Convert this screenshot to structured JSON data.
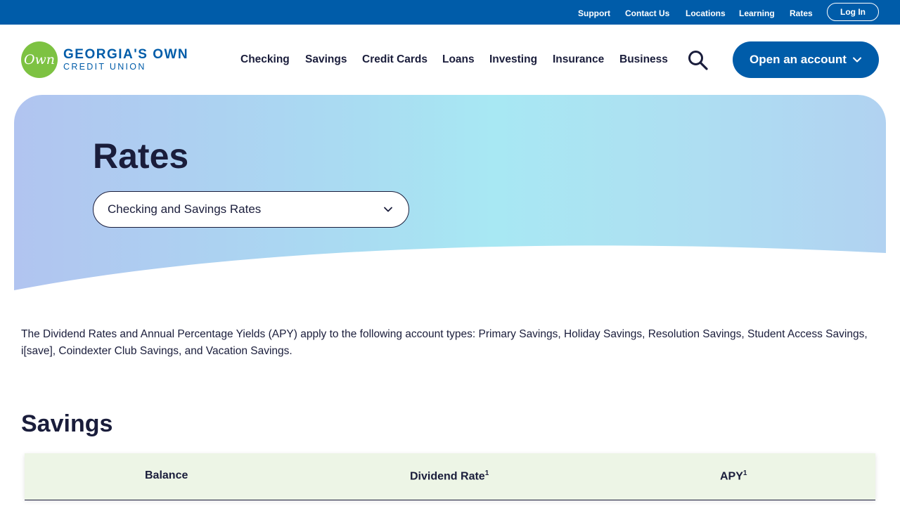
{
  "utility": {
    "links": [
      "Support",
      "Contact Us",
      "Locations",
      "Learning",
      "Rates"
    ],
    "login_label": "Log In"
  },
  "logo": {
    "mark": "Own",
    "title": "GEORGIA'S OWN",
    "subtitle": "CREDIT UNION"
  },
  "nav": {
    "items": [
      "Checking",
      "Savings",
      "Credit Cards",
      "Loans",
      "Investing",
      "Insurance",
      "Business"
    ],
    "open_account_label": "Open an account"
  },
  "hero": {
    "title": "Rates",
    "select_value": "Checking and Savings Rates"
  },
  "intro": {
    "text": "The Dividend Rates and Annual Percentage Yields (APY) apply to the following account types: Primary Savings, Holiday Savings, Resolution Savings, Student Access Savings, i[save], Coindexter Club Savings, and Vacation Savings."
  },
  "savings": {
    "title": "Savings",
    "columns": [
      {
        "label": "Balance",
        "sup": ""
      },
      {
        "label": "Dividend Rate",
        "sup": "1"
      },
      {
        "label": "APY",
        "sup": "1"
      }
    ]
  },
  "colors": {
    "brand_blue": "#005ca9",
    "brand_green": "#7dc242",
    "text_dark": "#1a1d3b",
    "table_head_bg": "#edf5e6"
  }
}
